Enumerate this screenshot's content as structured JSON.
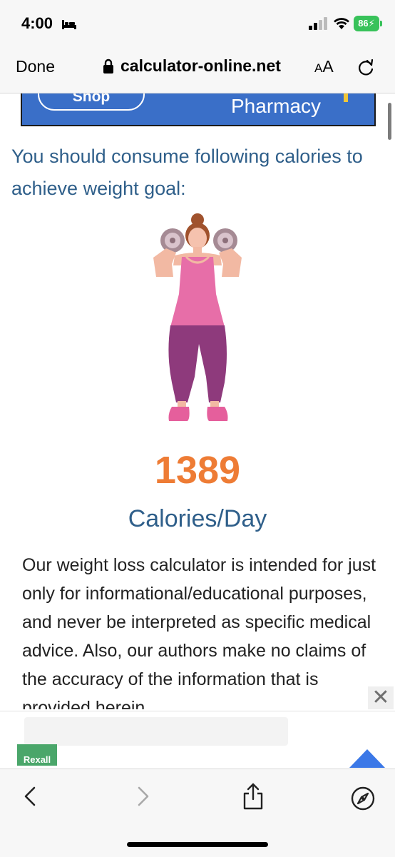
{
  "status_bar": {
    "time": "4:00",
    "battery": "86"
  },
  "browser": {
    "done_label": "Done",
    "url": "calculator-online.net",
    "text_size_label_small": "A",
    "text_size_label_large": "A"
  },
  "top_ad": {
    "button_label": "Shop",
    "brand_text": "Pharmacy",
    "color": "#3a6fc8"
  },
  "content": {
    "heading": "You should consume following calories to achieve weight goal:",
    "calories": "1389",
    "unit": "Calories/Day",
    "disclaimer": "Our weight loss calculator is intended for just only for informational/educational purposes, and never be interpreted as specific medical advice. Also, our authors make no claims of the accuracy of the information that is provided herein."
  },
  "bottom_ad": {
    "logo_text": "Rexall",
    "close_label": "✕"
  },
  "colors": {
    "accent_orange": "#ee7c35",
    "heading_blue": "#2f5f8a"
  },
  "icons": [
    "bed-icon",
    "signal-icon",
    "wifi-icon",
    "battery-icon",
    "lock-icon",
    "reload-icon",
    "back-icon",
    "forward-icon",
    "share-icon",
    "compass-icon"
  ]
}
